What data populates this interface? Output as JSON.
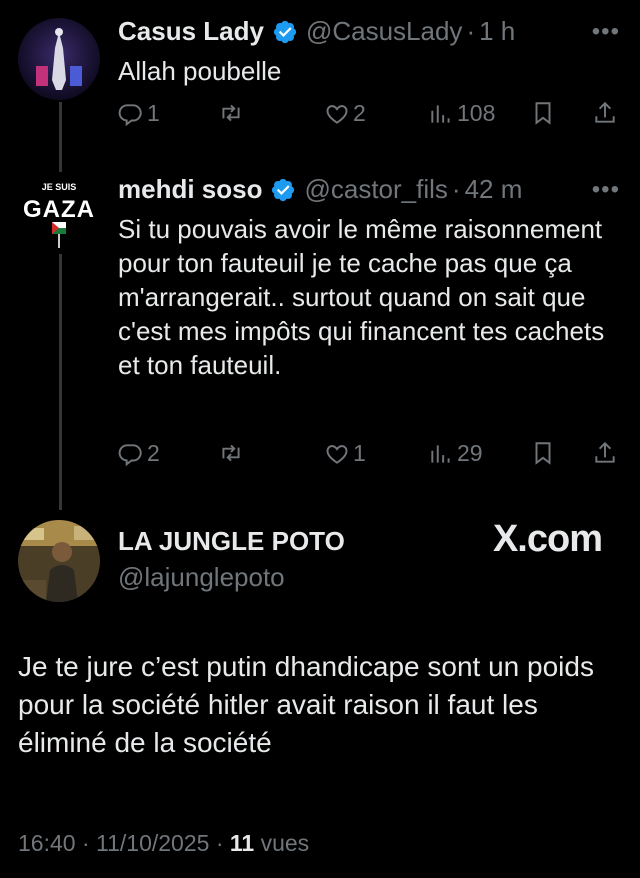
{
  "reply1": {
    "name": "Casus Lady",
    "handle": "@CasusLady",
    "separator": "·",
    "time": "1 h",
    "text": "Allah poubelle",
    "replies": "1",
    "reposts": "",
    "likes": "2",
    "views": "108"
  },
  "reply2": {
    "name": "mehdi soso",
    "handle": "@castor_fils",
    "separator": "·",
    "time": "42 m",
    "avatar_text_top": "JE SUIS",
    "avatar_text_main": "GAZA",
    "text": "Si tu pouvais avoir le même raisonnement pour ton fauteuil je te cache pas que ça m'arrangerait.. surtout quand on sait que c'est mes impôts qui financent tes cachets et ton fauteuil.",
    "replies": "2",
    "reposts": "",
    "likes": "1",
    "views": "29"
  },
  "main_tweet": {
    "name": "LA JUNGLE POTO",
    "handle": "@lajunglepoto",
    "watermark": "X.com",
    "text": "Je te jure c’est putin dhandicape sont un poids pour la société hitler avait raison il faut les éliminé de la société",
    "time": "16:40",
    "date": "11/10/2025",
    "views_count": "11",
    "views_label": "vues",
    "separator": "·"
  },
  "colors": {
    "background": "#000000",
    "text": "#e7e9ea",
    "muted": "#71767b",
    "verified": "#1d9bf0",
    "thread_line": "#333639"
  },
  "icons": [
    "reply-icon",
    "repost-icon",
    "like-icon",
    "views-icon",
    "bookmark-icon",
    "share-icon",
    "verified-icon",
    "more-icon"
  ]
}
